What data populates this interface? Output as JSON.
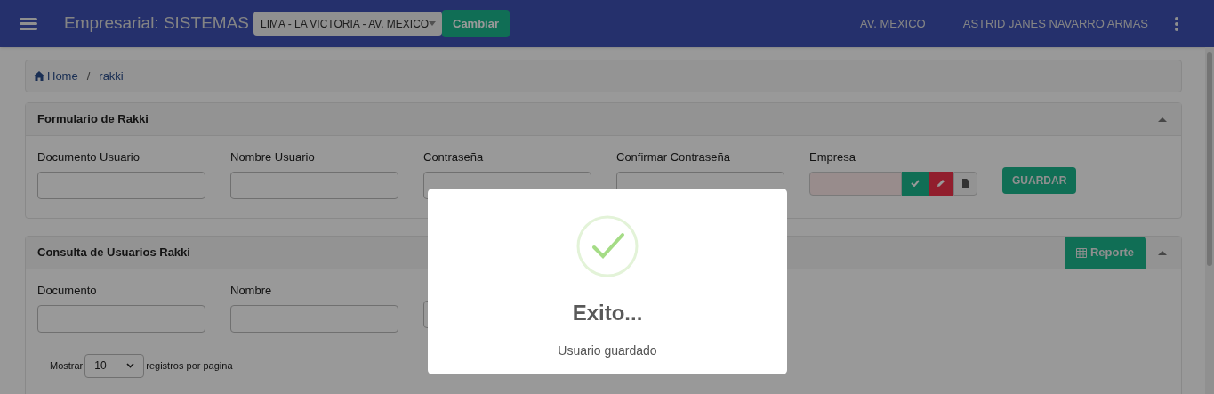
{
  "header": {
    "title": "Empresarial: SISTEMAS",
    "branch_select": "LIMA - LA VICTORIA - AV. MEXICO",
    "change_button": "Cambiar",
    "location": "AV. MEXICO",
    "user": "ASTRID JANES NAVARRO ARMAS"
  },
  "breadcrumb": {
    "items": [
      "Home",
      "rakki"
    ],
    "separator": "/"
  },
  "form_panel": {
    "title": "Formulario de Rakki",
    "fields": [
      {
        "label": "Documento Usuario"
      },
      {
        "label": "Nombre Usuario"
      },
      {
        "label": "Contraseña"
      },
      {
        "label": "Confirmar Contraseña"
      }
    ],
    "company": {
      "label": "Empresa"
    },
    "save_button": "GUARDAR"
  },
  "query_panel": {
    "title": "Consulta de Usuarios Rakki",
    "report_button": "Reporte",
    "fields": [
      {
        "kind": "labeled",
        "label": "Documento"
      },
      {
        "kind": "labeled",
        "label": "Nombre"
      },
      {
        "kind": "unlabeled"
      }
    ],
    "page_size": {
      "before": "Mostrar",
      "value": "10",
      "after": "registros por pagina"
    }
  },
  "dialog": {
    "title": "Exito...",
    "message": "Usuario guardado"
  }
}
